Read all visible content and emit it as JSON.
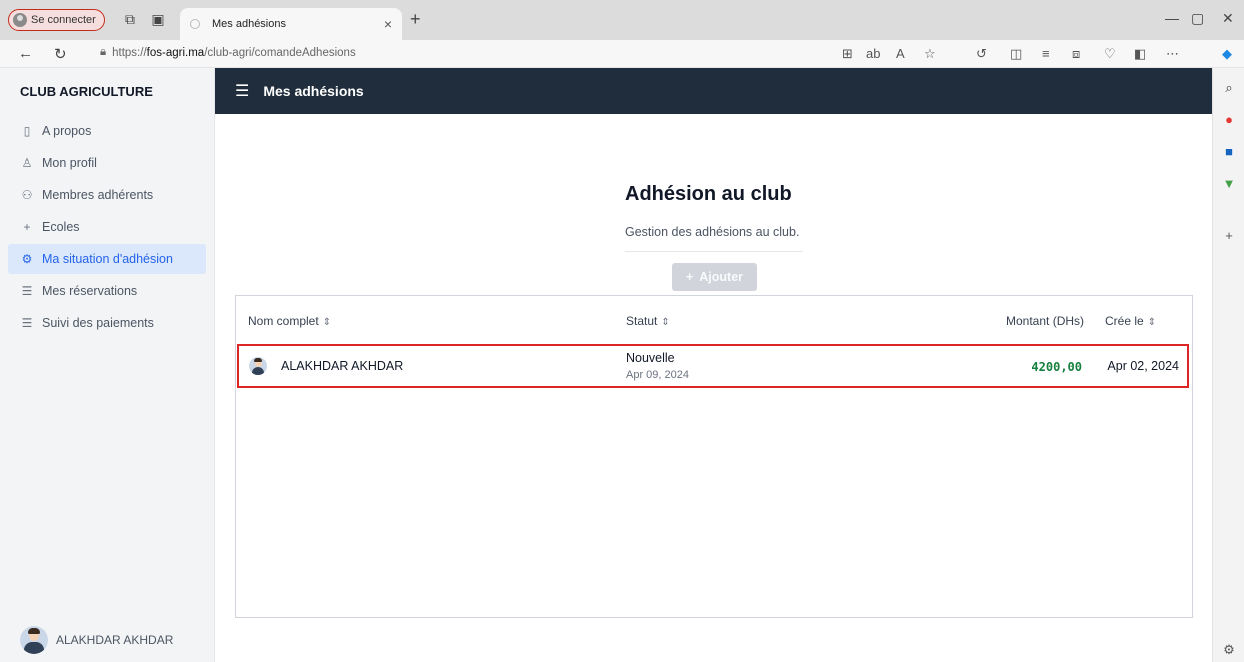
{
  "browser": {
    "profile_label": "Se connecter",
    "tab_title": "Mes adhésions",
    "tab_close": "×",
    "new_tab": "+",
    "url_path_prefix": "https://",
    "url_host": "fos-agri.ma",
    "url_path": "/club-agri/comandeAdhesions"
  },
  "sidebar": {
    "brand": "CLUB AGRICULTURE",
    "items": [
      {
        "label": "A propos",
        "icon": "document-icon",
        "active": false
      },
      {
        "label": "Mon profil",
        "icon": "user-settings-icon",
        "active": false
      },
      {
        "label": "Membres adhérents",
        "icon": "members-icon",
        "active": false
      },
      {
        "label": "Ecoles",
        "icon": "plus-icon",
        "active": false
      },
      {
        "label": "Ma situation d'adhésion",
        "icon": "gear-icon",
        "active": true
      },
      {
        "label": "Mes réservations",
        "icon": "list-icon",
        "active": false
      },
      {
        "label": "Suivi des paiements",
        "icon": "list-icon",
        "active": false
      }
    ],
    "user_name": "ALAKHDAR AKHDAR"
  },
  "header": {
    "title": "Mes adhésions"
  },
  "main": {
    "title": "Adhésion au club",
    "subtitle": "Gestion des adhésions au club.",
    "add_button": "Ajouter"
  },
  "table": {
    "columns": [
      "Nom complet",
      "Statut",
      "Montant (DHs)",
      "Crée le"
    ],
    "rows": [
      {
        "name": "ALAKHDAR AKHDAR",
        "status": "Nouvelle",
        "status_date": "Apr 09, 2024",
        "amount": "4200,00",
        "created": "Apr 02, 2024"
      }
    ]
  },
  "colors": {
    "header_bg": "#1f2d3d",
    "active_nav_bg": "#dbe8fb",
    "active_nav_text": "#2563eb",
    "amount_green": "#15803d",
    "highlight_border": "#dc2626"
  }
}
